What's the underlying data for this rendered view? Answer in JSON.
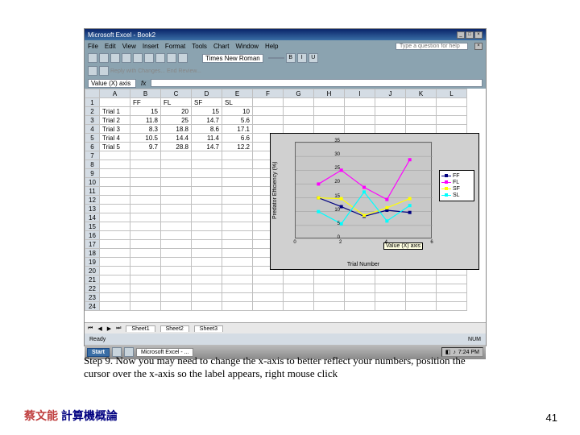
{
  "window": {
    "title": "Microsoft Excel - Book2",
    "help_placeholder": "Type a question for help"
  },
  "menu": [
    "File",
    "Edit",
    "View",
    "Insert",
    "Format",
    "Tools",
    "Chart",
    "Window",
    "Help"
  ],
  "font": {
    "name": "Times New Roman",
    "size": ""
  },
  "formula": {
    "namebox": "Value (X) axis"
  },
  "review_text": "Reply with Changes... End Review...",
  "columns": [
    "A",
    "B",
    "C",
    "D",
    "E",
    "F",
    "G",
    "H",
    "I",
    "J",
    "K",
    "L"
  ],
  "rows": [
    {
      "n": 1,
      "cells": [
        "",
        "FF",
        "FL",
        "SF",
        "SL"
      ]
    },
    {
      "n": 2,
      "cells": [
        "Trial 1",
        "15",
        "20",
        "15",
        "10"
      ]
    },
    {
      "n": 3,
      "cells": [
        "Trial 2",
        "11.8",
        "25",
        "14.7",
        "5.6"
      ]
    },
    {
      "n": 4,
      "cells": [
        "Trial 3",
        "8.3",
        "18.8",
        "8.6",
        "17.1"
      ]
    },
    {
      "n": 5,
      "cells": [
        "Trial 4",
        "10.5",
        "14.4",
        "11.4",
        "6.6"
      ]
    },
    {
      "n": 6,
      "cells": [
        "Trial 5",
        "9.7",
        "28.8",
        "14.7",
        "12.2"
      ]
    },
    {
      "n": 7,
      "cells": []
    },
    {
      "n": 8,
      "cells": []
    },
    {
      "n": 9,
      "cells": []
    },
    {
      "n": 10,
      "cells": []
    },
    {
      "n": 11,
      "cells": []
    },
    {
      "n": 12,
      "cells": []
    },
    {
      "n": 13,
      "cells": []
    },
    {
      "n": 14,
      "cells": []
    },
    {
      "n": 15,
      "cells": []
    },
    {
      "n": 16,
      "cells": []
    },
    {
      "n": 17,
      "cells": []
    },
    {
      "n": 18,
      "cells": []
    },
    {
      "n": 19,
      "cells": []
    },
    {
      "n": 20,
      "cells": []
    },
    {
      "n": 21,
      "cells": []
    },
    {
      "n": 22,
      "cells": []
    },
    {
      "n": 23,
      "cells": []
    },
    {
      "n": 24,
      "cells": []
    }
  ],
  "chart_data": {
    "type": "line",
    "x": [
      1,
      2,
      3,
      4,
      5
    ],
    "series": [
      {
        "name": "FF",
        "color": "#000080",
        "values": [
          15,
          11.8,
          8.3,
          10.5,
          9.7
        ]
      },
      {
        "name": "FL",
        "color": "#ff00ff",
        "values": [
          20,
          25,
          18.8,
          14.4,
          28.8
        ]
      },
      {
        "name": "SF",
        "color": "#ffff00",
        "values": [
          15,
          14.7,
          8.6,
          11.4,
          14.7
        ]
      },
      {
        "name": "SL",
        "color": "#00ffff",
        "values": [
          10,
          5.6,
          17.1,
          6.6,
          12.2
        ]
      }
    ],
    "ylabel": "Predator Efficiency (%)",
    "xlabel": "Trial Number",
    "ylim": [
      0,
      35
    ],
    "xlim": [
      0,
      6
    ],
    "yticks": [
      0,
      5,
      10,
      15,
      20,
      25,
      30,
      35
    ],
    "xticks": [
      0,
      2,
      4,
      6
    ],
    "tooltip": "Value (X) axis"
  },
  "sheets": [
    "Sheet1",
    "Sheet2",
    "Sheet3"
  ],
  "status": {
    "left": "Ready",
    "right": "NUM"
  },
  "taskbar": {
    "start": "Start",
    "app": "Microsoft Excel - ...",
    "clock": "7:24 PM"
  },
  "caption": "Step 9. Now you may need to change the x-axis to better reflect your numbers, position the cursor over the x-axis so the label appears, right mouse click",
  "footer": {
    "name": "蔡文能",
    "course": "計算機概論",
    "page": "41"
  }
}
